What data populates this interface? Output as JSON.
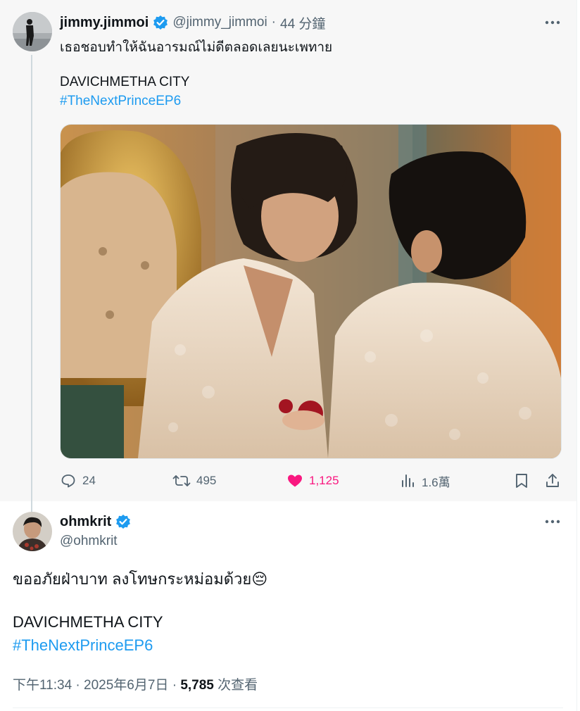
{
  "tweet1": {
    "display_name": "jimmy.jimmoi",
    "handle": "@jimmy_jimmoi",
    "separator": "·",
    "time": "44 分鐘",
    "text_line1": "เธอชอบทำให้ฉันอารมณ์ไม่ดีตลอดเลยนะเพทาย",
    "text_line2": "DAVICHMETHA CITY",
    "hashtag": "#TheNextPrinceEP6",
    "actions": {
      "replies": "24",
      "reposts": "495",
      "likes": "1,125",
      "views": "1.6萬"
    }
  },
  "tweet2": {
    "display_name": "ohmkrit",
    "handle": "@ohmkrit",
    "text_line1": "ขออภัยฝ่าบาท ลงโทษกระหม่อมด้วย😔",
    "text_line2": "DAVICHMETHA CITY",
    "hashtag": "#TheNextPrinceEP6",
    "meta_time": "下午11:34",
    "meta_sep": "·",
    "meta_date": "2025年6月7日",
    "meta_sep2": "·",
    "meta_views": "5,785",
    "meta_views_label": "次查看"
  },
  "colors": {
    "accent": "#1d9bf0",
    "like": "#f91880",
    "muted": "#536471"
  },
  "icons": [
    "verified-badge-icon",
    "more-icon",
    "reply-icon",
    "repost-icon",
    "heart-icon",
    "views-icon",
    "bookmark-icon",
    "share-icon"
  ]
}
